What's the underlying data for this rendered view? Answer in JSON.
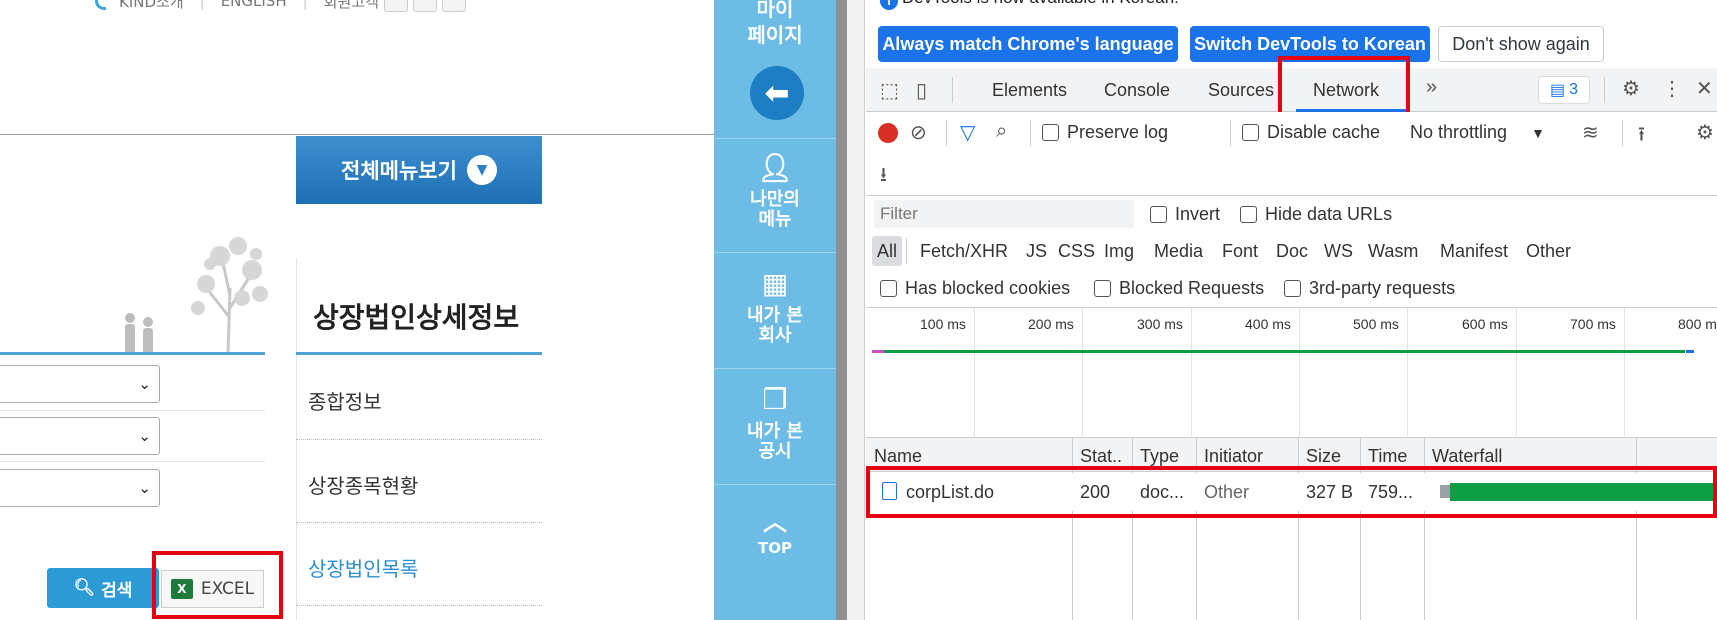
{
  "site": {
    "topnav": [
      "KIND소개",
      "ENGLISH",
      "회원고객"
    ],
    "menu_all": "전체메뉴보기",
    "search_button": "검색",
    "excel_button": "EXCEL",
    "side_title": "상장법인상세정보",
    "side_items": [
      "종합정보",
      "상장종목현황",
      "상장법인목록"
    ],
    "quickbar": {
      "title": "마이\n페이지",
      "items": [
        "나만의\n메뉴",
        "내가 본\n회사",
        "내가 본\n공시",
        "TOP"
      ]
    }
  },
  "devtools": {
    "info": "DevTools is now available in Korean!",
    "banner_buttons": [
      "Always match Chrome's language",
      "Switch DevTools to Korean",
      "Don't show again"
    ],
    "tabs": [
      "Elements",
      "Console",
      "Sources",
      "Network"
    ],
    "active_tab": "Network",
    "issues_count": "3",
    "toolbar": {
      "preserve_log": "Preserve log",
      "disable_cache": "Disable cache",
      "throttling": "No throttling"
    },
    "filter_placeholder": "Filter",
    "invert": "Invert",
    "hide_data_urls": "Hide data URLs",
    "type_filters": [
      "All",
      "Fetch/XHR",
      "JS",
      "CSS",
      "Img",
      "Media",
      "Font",
      "Doc",
      "WS",
      "Wasm",
      "Manifest",
      "Other"
    ],
    "blocked_cookies": "Has blocked cookies",
    "blocked_requests": "Blocked Requests",
    "third_party": "3rd-party requests",
    "timeline_ticks": [
      "100 ms",
      "200 ms",
      "300 ms",
      "400 ms",
      "500 ms",
      "600 ms",
      "700 ms",
      "800 m"
    ],
    "columns": [
      "Name",
      "Stat..",
      "Type",
      "Initiator",
      "Size",
      "Time",
      "Waterfall"
    ],
    "rows": [
      {
        "name": "corpList.do",
        "status": "200",
        "type": "doc...",
        "initiator": "Other",
        "size": "327 B",
        "time": "759..."
      }
    ]
  }
}
